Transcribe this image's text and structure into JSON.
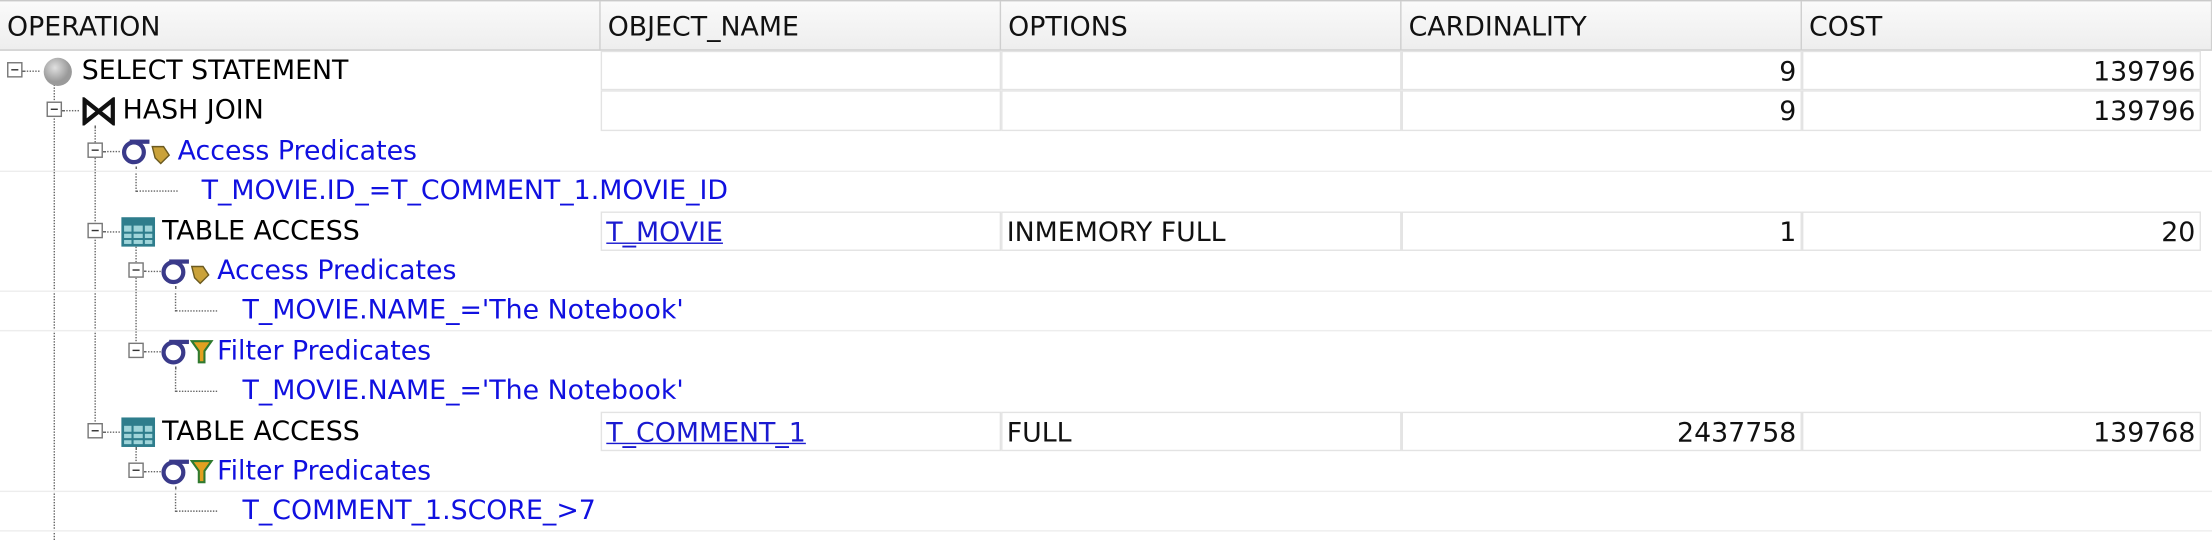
{
  "columns": [
    "OPERATION",
    "OBJECT_NAME",
    "OPTIONS",
    "CARDINALITY",
    "COST"
  ],
  "rows": [
    {
      "operation": "SELECT STATEMENT",
      "object_name": "",
      "options": "",
      "cardinality": "9",
      "cost": "139796",
      "icon": "select-statement-icon"
    },
    {
      "operation": "HASH JOIN",
      "object_name": "",
      "options": "",
      "cardinality": "9",
      "cost": "139796",
      "icon": "hash-join-icon"
    },
    {
      "operation": "Access Predicates",
      "icon": "access-predicates-icon"
    },
    {
      "operation": "T_MOVIE.ID_=T_COMMENT_1.MOVIE_ID"
    },
    {
      "operation": "TABLE ACCESS",
      "object_name": "T_MOVIE",
      "options": "INMEMORY FULL",
      "cardinality": "1",
      "cost": "20",
      "icon": "table-icon"
    },
    {
      "operation": "Access Predicates",
      "icon": "access-predicates-icon"
    },
    {
      "operation": "T_MOVIE.NAME_='The Notebook'"
    },
    {
      "operation": "Filter Predicates",
      "icon": "filter-predicates-icon"
    },
    {
      "operation": "T_MOVIE.NAME_='The Notebook'"
    },
    {
      "operation": "TABLE ACCESS",
      "object_name": "T_COMMENT_1",
      "options": "FULL",
      "cardinality": "2437758",
      "cost": "139768",
      "icon": "table-icon"
    },
    {
      "operation": "Filter Predicates",
      "icon": "filter-predicates-icon"
    },
    {
      "operation": "T_COMMENT_1.SCORE_>7"
    }
  ],
  "colors": {
    "predicate_text": "#1010e0",
    "link": "#1a1ad0",
    "table_icon": "#2e7d8c"
  }
}
